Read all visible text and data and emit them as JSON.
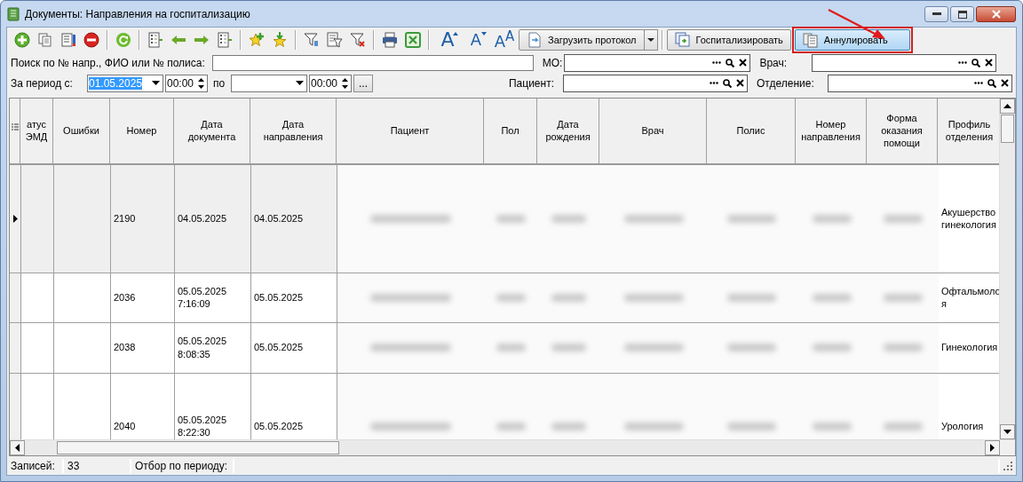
{
  "window": {
    "title": "Документы: Направления на госпитализацию"
  },
  "toolbar": {
    "font_buttons": [
      {
        "kind": "grow",
        "glyph": "A"
      },
      {
        "kind": "shrink",
        "glyph": "A"
      },
      {
        "kind": "reset",
        "glyph": "A$^{A}$"
      }
    ],
    "buttons": [
      {
        "kind": "load",
        "label": "Загрузить протокол",
        "has_dropdown": true,
        "highlighted": false,
        "annotated": false
      },
      {
        "kind": "hospitalize",
        "label": "Госпитализировать",
        "has_dropdown": false,
        "highlighted": false,
        "annotated": false
      },
      {
        "kind": "cancel",
        "label": "Аннулировать",
        "has_dropdown": false,
        "highlighted": true,
        "annotated": true
      }
    ]
  },
  "filters": {
    "search": {
      "label": "Поиск по № напр., ФИО или № полиса:"
    },
    "period": {
      "label": "За период с:",
      "date_from": "01.05.2025",
      "date_from_selected": true,
      "time_from": "00:00",
      "to_label": "по",
      "time_to": "00:00",
      "more_button": "..."
    },
    "lookups": [
      {
        "label": "МО:"
      },
      {
        "label": "Врач:"
      },
      {
        "label": "Пациент:"
      },
      {
        "label": "Отделение:"
      }
    ]
  },
  "table": {
    "columns": [
      {
        "label": "атус\nЭМД",
        "kind": "text"
      },
      {
        "label": "Ошибки",
        "kind": "text"
      },
      {
        "label": "Номер",
        "kind": "text"
      },
      {
        "label": "Дата\nдокумента",
        "kind": "text"
      },
      {
        "label": "Дата\nнаправления",
        "kind": "text"
      },
      {
        "label": "Пациент",
        "kind": "redacted"
      },
      {
        "label": "Пол",
        "kind": "redacted"
      },
      {
        "label": "Дата\nрождения",
        "kind": "redacted"
      },
      {
        "label": "Врач",
        "kind": "redacted"
      },
      {
        "label": "Полис",
        "kind": "redacted"
      },
      {
        "label": "Номер\nнаправления",
        "kind": "redacted"
      },
      {
        "label": "Форма\nоказания\nпомощи",
        "kind": "redacted"
      },
      {
        "label": "Профиль\nотделения",
        "kind": "text"
      }
    ],
    "rows": [
      {
        "selected": true,
        "number": "2190",
        "document_date": "04.05.2025",
        "referral_date": "04.05.2025",
        "profile": "Акушерство\nгинекология"
      },
      {
        "selected": false,
        "number": "2036",
        "document_date": "05.05.2025\n7:16:09",
        "referral_date": "05.05.2025",
        "profile": "Офтальмоло\nя"
      },
      {
        "selected": false,
        "number": "2038",
        "document_date": "05.05.2025\n8:08:35",
        "referral_date": "05.05.2025",
        "profile": "Гинекология"
      },
      {
        "selected": false,
        "number": "2040",
        "document_date": "05.05.2025\n8:22:30",
        "referral_date": "05.05.2025",
        "profile": "Урология"
      }
    ]
  },
  "status_bar": {
    "records_label": "Записей:",
    "records_count": "33",
    "period_label": "Отбор по периоду:"
  }
}
